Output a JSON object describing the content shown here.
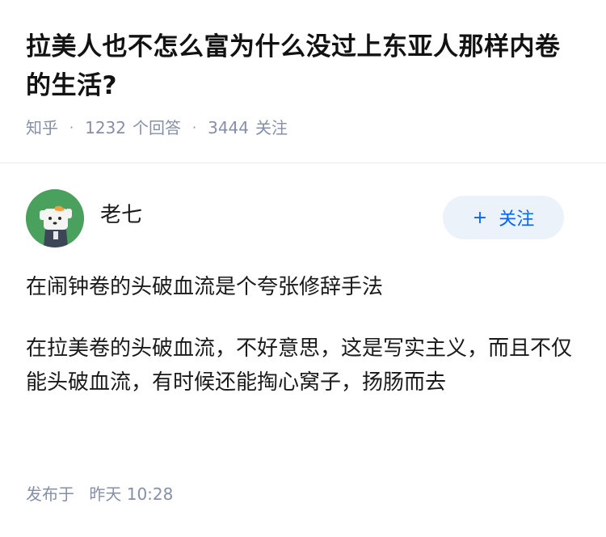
{
  "question": {
    "title": "拉美人也不怎么富为什么没过上东亚人那样内卷的生活?",
    "source": "知乎",
    "answer_count": "1232",
    "answer_label": "个回答",
    "follow_count": "3444",
    "follow_label": "关注"
  },
  "answer": {
    "author_name": "老七",
    "follow_button": "关注",
    "follow_plus": "+",
    "paragraphs": [
      "在闹钟卷的头破血流是个夸张修辞手法",
      "在拉美卷的头破血流，不好意思，这是写实主义，而且不仅能头破血流，有时候还能掏心窝子，扬肠而去"
    ],
    "publish_label": "发布于",
    "publish_time": "昨天 10:28"
  },
  "colors": {
    "accent": "#0066ff",
    "follow_bg": "#ebf2fa",
    "meta_text": "#8590a6",
    "avatar_bg": "#4aa15d"
  }
}
